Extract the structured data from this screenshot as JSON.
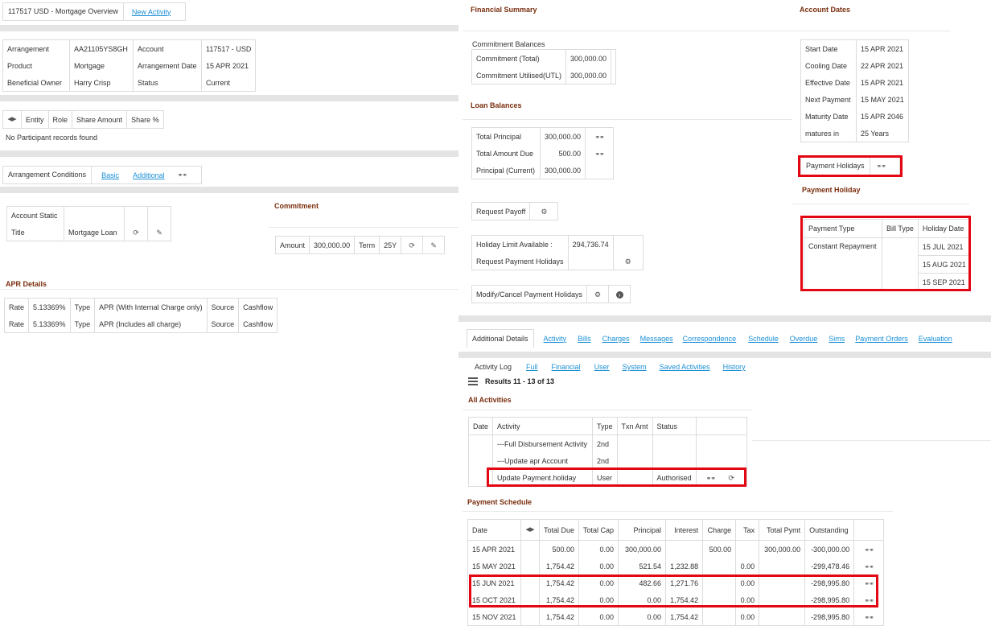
{
  "header": {
    "title": "117517 USD - Mortgage Overview",
    "new_activity": "New Activity"
  },
  "arrangement": {
    "rows": [
      [
        "Arrangement",
        "AA21105YS8GH",
        "Account",
        "117517 - USD"
      ],
      [
        "Product",
        "Mortgage",
        "Arrangement Date",
        "15 APR 2021"
      ],
      [
        "Beneficial Owner",
        "Harry Crisp",
        "Status",
        "Current"
      ]
    ]
  },
  "participants": {
    "headers": [
      "Entity",
      "Role",
      "Share Amount",
      "Share %"
    ],
    "empty": "No Participant records found"
  },
  "conditions": {
    "label": "Arrangement Conditions",
    "basic": "Basic",
    "additional": "Additional"
  },
  "account_static": {
    "label": "Account Static",
    "title_label": "Title",
    "title_value": "Mortgage Loan"
  },
  "commitment": {
    "title": "Commitment",
    "amount_label": "Amount",
    "amount": "300,000.00",
    "term_label": "Term",
    "term": "25Y"
  },
  "apr": {
    "title": "APR Details",
    "rows": [
      [
        "Rate",
        "5.13369%",
        "Type",
        "APR (With Internal Charge only)",
        "Source",
        "Cashflow"
      ],
      [
        "Rate",
        "5.13369%",
        "Type",
        "APR (Includes all charge)",
        "Source",
        "Cashflow"
      ]
    ]
  },
  "financial": {
    "title": "Financial Summary",
    "commitment_balances": "Commitment Balances",
    "commit_rows": [
      [
        "Commitment (Total)",
        "300,000.00"
      ],
      [
        "Commitment Utilised(UTL)",
        "300,000.00"
      ]
    ],
    "loan_title": "Loan Balances",
    "loan_rows": [
      [
        "Total Principal",
        "300,000.00"
      ],
      [
        "Total Amount Due",
        "500.00"
      ],
      [
        "Principal (Current)",
        "300,000.00"
      ]
    ],
    "request_payoff": "Request Payoff",
    "holiday_limit_label": "Holiday Limit Available :",
    "holiday_limit": "294,736.74",
    "request_holidays": "Request Payment Holidays",
    "modify_holidays": "Modify/Cancel Payment Holidays"
  },
  "dates": {
    "title": "Account Dates",
    "rows": [
      [
        "Start Date",
        "15 APR 2021"
      ],
      [
        "Cooling Date",
        "22 APR 2021"
      ],
      [
        "Effective Date",
        "15 APR 2021"
      ],
      [
        "Next Payment",
        "15 MAY 2021"
      ],
      [
        "Maturity Date",
        "15 APR 2046"
      ],
      [
        "matures in",
        "25 Years"
      ]
    ],
    "payment_holidays": "Payment Holidays"
  },
  "payment_holiday": {
    "title": "Payment Holiday",
    "headers": [
      "Payment Type",
      "Bill Type",
      "Holiday Date"
    ],
    "type": "Constant Repayment",
    "dates": [
      "15 JUL 2021",
      "15 AUG 2021",
      "15 SEP 2021"
    ]
  },
  "tabs": [
    "Additional Details",
    "Activity",
    "Bills",
    "Charges",
    "Messages",
    "Correspondence",
    "Schedule",
    "Overdue",
    "Sims",
    "Payment Orders",
    "Evaluation"
  ],
  "activity_log": {
    "label": "Activity Log",
    "links": [
      "Full",
      "Financial",
      "User",
      "System",
      "Saved Activities",
      "History"
    ],
    "results": "Results 11 - 13 of 13"
  },
  "all_activities": {
    "title": "All Activities",
    "headers": [
      "Date",
      "Activity",
      "Type",
      "Txn Amt",
      "Status"
    ],
    "rows": [
      [
        "",
        "---Full Disbursement Activity",
        "2nd",
        "",
        ""
      ],
      [
        "",
        "---Update apr Account",
        "2nd",
        "",
        ""
      ],
      [
        "",
        "Update Payment.holiday",
        "User",
        "",
        "Authorised"
      ]
    ]
  },
  "schedule": {
    "title": "Payment Schedule",
    "headers": [
      "Date",
      "",
      "Total Due",
      "Total Cap",
      "Principal",
      "Interest",
      "Charge",
      "Tax",
      "Total Pymt",
      "Outstanding"
    ],
    "rows": [
      [
        "15 APR 2021",
        "",
        "500.00",
        "0.00",
        "300,000.00",
        "",
        "500.00",
        "",
        "300,000.00",
        "-300,000.00"
      ],
      [
        "15 MAY 2021",
        "",
        "1,754.42",
        "0.00",
        "521.54",
        "1,232.88",
        "",
        "0.00",
        "",
        "-299,478.46"
      ],
      [
        "15 JUN 2021",
        "",
        "1,754.42",
        "0.00",
        "482.66",
        "1,271.76",
        "",
        "0.00",
        "",
        "-298,995.80"
      ],
      [
        "15 OCT 2021",
        "",
        "1,754.42",
        "0.00",
        "0.00",
        "1,754.42",
        "",
        "0.00",
        "",
        "-298,995.80"
      ],
      [
        "15 NOV 2021",
        "",
        "1,754.42",
        "0.00",
        "0.00",
        "1,754.42",
        "",
        "0.00",
        "",
        "-298,995.80"
      ]
    ]
  }
}
